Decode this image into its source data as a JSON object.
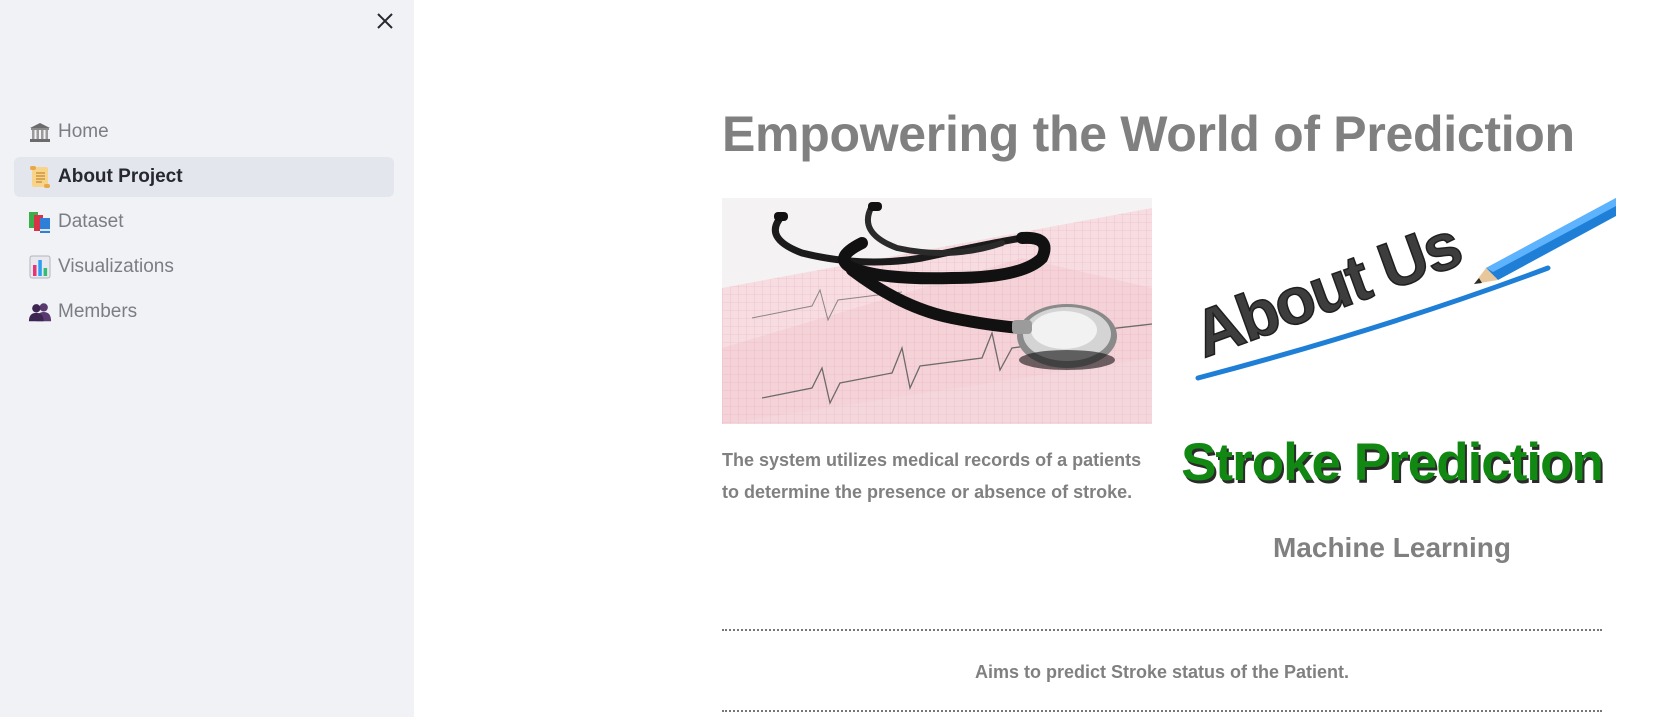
{
  "sidebar": {
    "close_icon": "close-icon",
    "items": [
      {
        "label": "Home",
        "icon": "classical-building-icon",
        "active": false
      },
      {
        "label": "About Project",
        "icon": "scroll-icon",
        "active": true
      },
      {
        "label": "Dataset",
        "icon": "books-icon",
        "active": false
      },
      {
        "label": "Visualizations",
        "icon": "bar-chart-icon",
        "active": false
      },
      {
        "label": "Members",
        "icon": "busts-in-silhouette-icon",
        "active": false
      }
    ]
  },
  "main": {
    "title": "Empowering the World of Prediction",
    "description": "The system utilizes medical records of a patients to determine the presence or absence of stroke.",
    "images": {
      "left": "stethoscope-ecg-image",
      "right": "about-us-pencil-image",
      "right_text": "About Us"
    },
    "stroke_title": "Stroke Prediction",
    "subtitle": "Machine Learning",
    "aims": "Aims to predict Stroke status of the Patient."
  },
  "colors": {
    "sidebar_bg": "#f0f2f6",
    "active_item_bg": "#e3e6ec",
    "muted_text": "#808080",
    "stroke_green": "#118811",
    "pencil_blue": "#1f7fd6"
  }
}
